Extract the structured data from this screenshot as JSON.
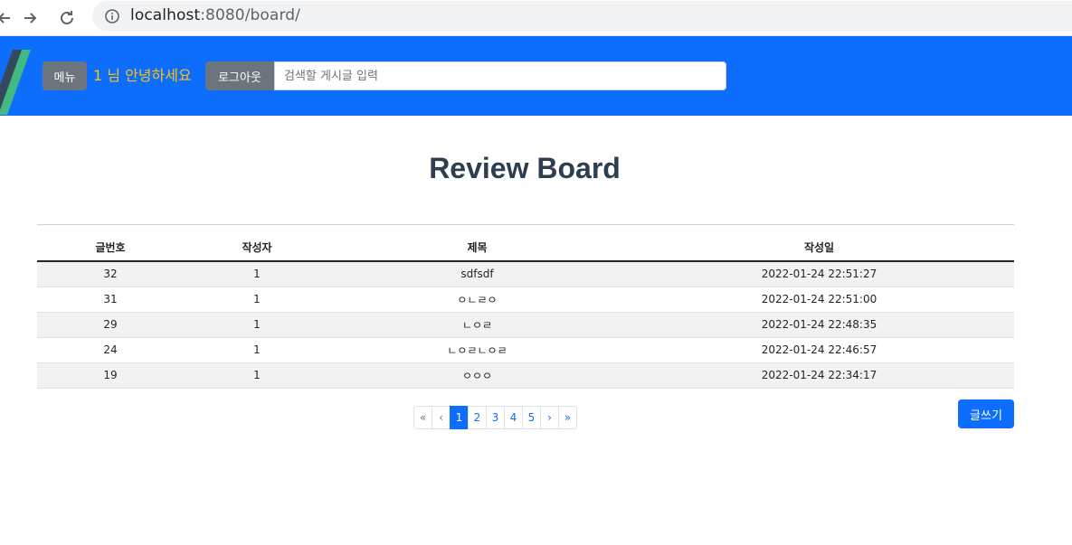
{
  "browser": {
    "url_host": "localhost",
    "url_rest": ":8080/board/",
    "back_icon": "arrow-left-icon",
    "forward_icon": "arrow-right-icon",
    "reload_icon": "reload-icon",
    "info_icon": "info-icon"
  },
  "header": {
    "menu_label": "메뉴",
    "greeting": "1 님 안녕하세요",
    "logout_label": "로그아웃",
    "search_placeholder": "검색할 게시글 입력",
    "colors": {
      "bar": "#0d6efd",
      "greeting": "#ffc107",
      "button": "#6c757d"
    }
  },
  "main": {
    "title": "Review Board",
    "columns": [
      "글번호",
      "작성자",
      "제목",
      "작성일"
    ],
    "rows": [
      [
        "32",
        "1",
        "sdfsdf",
        "2022-01-24 22:51:27"
      ],
      [
        "31",
        "1",
        "ㅇㄴㄹㅇ",
        "2022-01-24 22:51:00"
      ],
      [
        "29",
        "1",
        "ㄴㅇㄹ",
        "2022-01-24 22:48:35"
      ],
      [
        "24",
        "1",
        "ㄴㅇㄹㄴㅇㄹ",
        "2022-01-24 22:46:57"
      ],
      [
        "19",
        "1",
        "ㅇㅇㅇ",
        "2022-01-24 22:34:17"
      ]
    ],
    "pagination": {
      "first": "«",
      "prev": "‹",
      "pages": [
        "1",
        "2",
        "3",
        "4",
        "5"
      ],
      "active_page": "1",
      "next": "›",
      "last": "»"
    },
    "write_label": "글쓰기"
  }
}
